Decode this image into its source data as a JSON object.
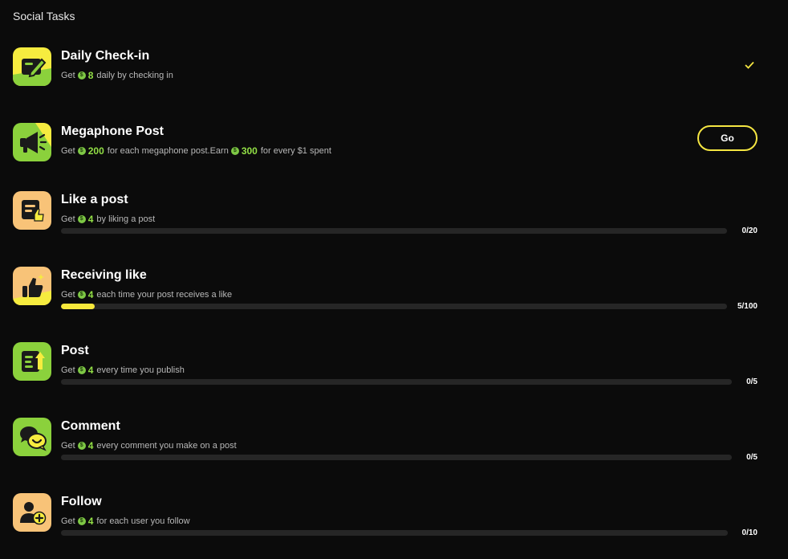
{
  "section_title": "Social Tasks",
  "colors": {
    "background": "#0b0b0b",
    "accent_yellow": "#f5e642",
    "accent_green": "#93e046",
    "bar_track": "#262626",
    "icon_green": "#8bd13c",
    "icon_peach": "#f8c378"
  },
  "tasks": [
    {
      "title": "Daily Check-in",
      "desc_pre": "Get",
      "amount": "8",
      "desc_post": "daily by checking in",
      "status": "completed",
      "icon": "pencil-note-icon"
    },
    {
      "title": "Megaphone Post",
      "desc_pre": "Get",
      "amount": "200",
      "desc_mid": "for each megaphone post.Earn",
      "amount2": "300",
      "desc_post": "for every $1 spent",
      "button_label": "Go",
      "icon": "megaphone-icon"
    },
    {
      "title": "Like a post",
      "desc_pre": "Get",
      "amount": "4",
      "desc_post": "by liking a post",
      "progress_text": "0/20",
      "progress": 0.0,
      "icon": "like-note-icon"
    },
    {
      "title": "Receiving like",
      "desc_pre": "Get",
      "amount": "4",
      "desc_post": "each time your post receives a like",
      "progress_text": "5/100",
      "progress": 0.05,
      "icon": "thumbs-up-icon"
    },
    {
      "title": "Post",
      "desc_pre": "Get",
      "amount": "4",
      "desc_post": "every time you publish",
      "progress_text": "0/5",
      "progress": 0.0,
      "icon": "publish-icon"
    },
    {
      "title": "Comment",
      "desc_pre": "Get",
      "amount": "4",
      "desc_post": "every comment you make on a post",
      "progress_text": "0/5",
      "progress": 0.0,
      "icon": "comment-bubbles-icon"
    },
    {
      "title": "Follow",
      "desc_pre": "Get",
      "amount": "4",
      "desc_post": "for each user you follow",
      "progress_text": "0/10",
      "progress": 0.0,
      "icon": "add-user-icon"
    }
  ],
  "coin_symbol": "$"
}
